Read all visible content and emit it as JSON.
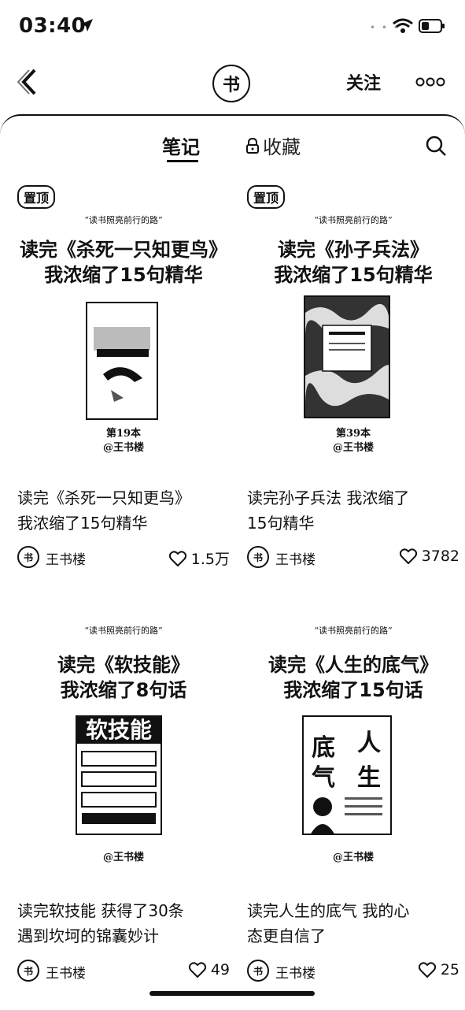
{
  "status": {
    "time": "03:40"
  },
  "topbar": {
    "avatar_text": "书",
    "follow_label": "关注"
  },
  "tabs": {
    "notes": "笔记",
    "favorites": "收藏"
  },
  "cards": [
    {
      "pinned_label": "置顶",
      "slogan": "“读书照亮前行的路”",
      "cover_title": "读完《杀死一只知更鸟》\n我浓缩了15句精华",
      "book_caption": "第19本\n@王书楼",
      "title": "读完《杀死一只知更鸟》\n我浓缩了15句精华",
      "author": "王书楼",
      "likes": "1.5万"
    },
    {
      "pinned_label": "置顶",
      "slogan": "“读书照亮前行的路”",
      "cover_title": "读完《孙子兵法》\n我浓缩了15句精华",
      "book_caption": "第39本\n@王书楼",
      "title": "读完孙子兵法 我浓缩了\n15句精华",
      "author": "王书楼",
      "likes": "3782"
    },
    {
      "slogan": "“读书照亮前行的路”",
      "cover_title": "读完《软技能》\n我浓缩了8句话",
      "book_caption": "@王书楼",
      "book_text": "软技能",
      "title": "读完软技能 获得了30条\n遇到坎坷的锦囊妙计",
      "author": "王书楼",
      "likes": "49"
    },
    {
      "slogan": "“读书照亮前行的路”",
      "cover_title": "读完《人生的底气》\n我浓缩了15句话",
      "book_caption": "@王书楼",
      "book_text_a": "底",
      "book_text_b": "人",
      "book_text_c": "气",
      "book_text_d": "生",
      "title": "读完人生的底气 我的心\n态更自信了",
      "author": "王书楼",
      "likes": "25"
    }
  ]
}
